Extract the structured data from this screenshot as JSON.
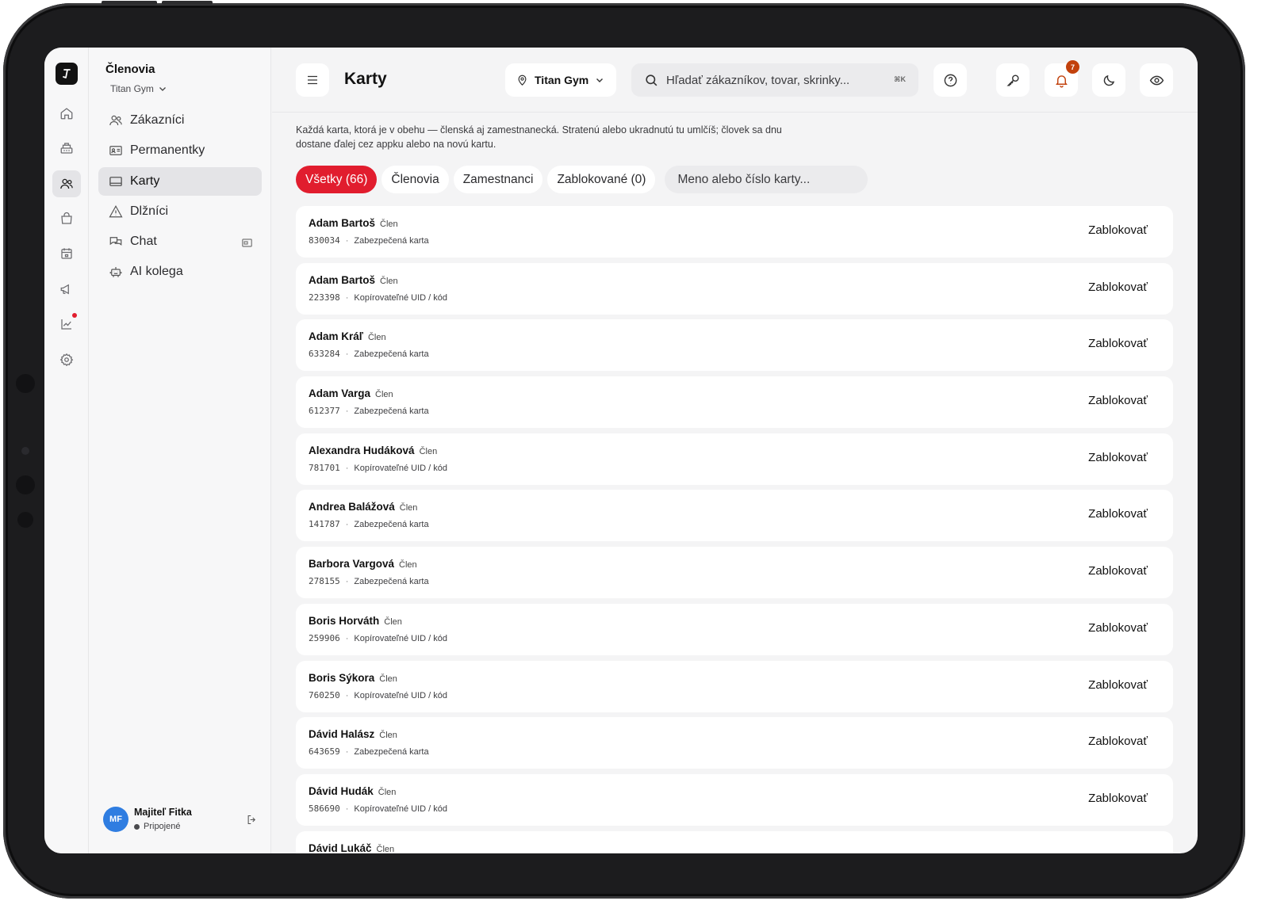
{
  "sidebar": {
    "title": "Členovia",
    "gym": "Titan Gym",
    "items": [
      {
        "label": "Zákazníci",
        "icon": "users-icon"
      },
      {
        "label": "Permanentky",
        "icon": "id-card-icon"
      },
      {
        "label": "Karty",
        "icon": "card-icon",
        "active": true
      },
      {
        "label": "Dlžníci",
        "icon": "warning-icon"
      },
      {
        "label": "Chat",
        "icon": "chat-icon"
      },
      {
        "label": "AI kolega",
        "icon": "robot-icon"
      }
    ],
    "user": {
      "initials": "MF",
      "name": "Majiteľ Fitka",
      "status": "Pripojené"
    }
  },
  "header": {
    "title": "Karty",
    "gym_select": "Titan Gym",
    "search_placeholder": "Hľadať zákazníkov, tovar, skrinky...",
    "search_shortcut": "⌘K",
    "notification_count": "7"
  },
  "main": {
    "intro": "Každá karta, ktorá je v obehu — členská aj zamestnanecká. Stratenú alebo ukradnutú tu umlčíš; človek sa dnu dostane ďalej cez appku alebo na novú kartu.",
    "tabs": [
      "Všetky (66)",
      "Členovia",
      "Zamestnanci",
      "Zablokované (0)"
    ],
    "filter_placeholder": "Meno alebo číslo karty...",
    "block_label": "Zablokovať",
    "separator": "·",
    "rows": [
      {
        "name": "Adam Bartoš",
        "role": "Člen",
        "code": "830034",
        "type": "Zabezpečená karta"
      },
      {
        "name": "Adam Bartoš",
        "role": "Člen",
        "code": "223398",
        "type": "Kopírovateľné UID / kód"
      },
      {
        "name": "Adam Kráľ",
        "role": "Člen",
        "code": "633284",
        "type": "Zabezpečená karta"
      },
      {
        "name": "Adam Varga",
        "role": "Člen",
        "code": "612377",
        "type": "Zabezpečená karta"
      },
      {
        "name": "Alexandra Hudáková",
        "role": "Člen",
        "code": "781701",
        "type": "Kopírovateľné UID / kód"
      },
      {
        "name": "Andrea Balážová",
        "role": "Člen",
        "code": "141787",
        "type": "Zabezpečená karta"
      },
      {
        "name": "Barbora Vargová",
        "role": "Člen",
        "code": "278155",
        "type": "Zabezpečená karta"
      },
      {
        "name": "Boris Horváth",
        "role": "Člen",
        "code": "259906",
        "type": "Kopírovateľné UID / kód"
      },
      {
        "name": "Boris Sýkora",
        "role": "Člen",
        "code": "760250",
        "type": "Kopírovateľné UID / kód"
      },
      {
        "name": "Dávid Halász",
        "role": "Člen",
        "code": "643659",
        "type": "Zabezpečená karta"
      },
      {
        "name": "Dávid Hudák",
        "role": "Člen",
        "code": "586690",
        "type": "Kopírovateľné UID / kód"
      },
      {
        "name": "Dávid Lukáč",
        "role": "Člen",
        "code": "",
        "type": ""
      }
    ]
  },
  "colors": {
    "accent": "#e11d2e",
    "notification": "#c2410c",
    "avatar": "#2f7de1"
  }
}
